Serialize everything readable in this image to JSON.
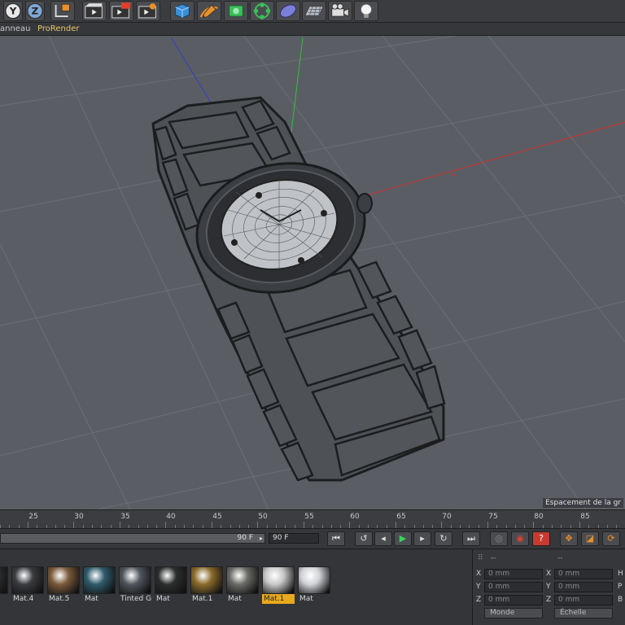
{
  "toolbar": {
    "buttons": [
      {
        "icon": "axis-y-icon",
        "label": "Y"
      },
      {
        "icon": "axis-z-icon",
        "label": "Z"
      },
      {
        "icon": "coordinate-system-icon"
      },
      {
        "icon": "render-view-icon"
      },
      {
        "icon": "render-picture-viewer-icon"
      },
      {
        "icon": "render-settings-icon"
      },
      {
        "icon": "cube-primitive-icon"
      },
      {
        "icon": "pen-spline-icon"
      },
      {
        "icon": "nurbs-icon"
      },
      {
        "icon": "array-cloner-icon"
      },
      {
        "icon": "deformer-icon"
      },
      {
        "icon": "floor-scene-icon"
      },
      {
        "icon": "camera-icon"
      },
      {
        "icon": "light-icon"
      }
    ]
  },
  "menubar": {
    "items": [
      "anneau",
      "ProRender"
    ]
  },
  "viewport": {
    "grid_spacing_label": "Espacement de la gr"
  },
  "timeline": {
    "ticks": [
      "25",
      "30",
      "35",
      "40",
      "45",
      "50",
      "55",
      "60",
      "65",
      "70",
      "75",
      "80",
      "85"
    ]
  },
  "transport": {
    "slider_value": "90 F",
    "slider_arrow": "▸",
    "end_frame": "90 F",
    "buttons": [
      {
        "icon": "go-to-start-icon",
        "glyph": "⏮"
      },
      {
        "icon": "go-to-previous-keyframe-icon",
        "glyph": "↺"
      },
      {
        "icon": "previous-frame-icon",
        "glyph": "◂"
      },
      {
        "icon": "play-forward-icon",
        "glyph": "▶"
      },
      {
        "icon": "next-frame-icon",
        "glyph": "▸"
      },
      {
        "icon": "go-to-next-keyframe-icon",
        "glyph": "↻"
      },
      {
        "icon": "go-to-end-icon",
        "glyph": "⏭"
      },
      {
        "icon": "record-keyframes-icon",
        "glyph": "◎"
      },
      {
        "icon": "autokeying-icon",
        "glyph": "◉"
      },
      {
        "icon": "keyframe-selection-icon",
        "glyph": "?"
      },
      {
        "icon": "record-position-icon",
        "glyph": "✥"
      },
      {
        "icon": "record-scale-icon",
        "glyph": "◪"
      },
      {
        "icon": "record-rotation-icon",
        "glyph": "⟳"
      }
    ]
  },
  "materials": [
    {
      "label": "",
      "color": "#2d2f32"
    },
    {
      "label": "Mat.4",
      "color": "#3a3c40"
    },
    {
      "label": "Mat.5",
      "color": "#7a5a3a"
    },
    {
      "label": "Mat",
      "color": "#2e5a6a"
    },
    {
      "label": "Tinted G",
      "color": "#50545c"
    },
    {
      "label": "Mat",
      "color": "#2c2e2e"
    },
    {
      "label": "Mat.1",
      "color": "#8a6a2a"
    },
    {
      "label": "Mat",
      "color": "#6a6a66"
    },
    {
      "label": "Mat.1",
      "color": "#c8c8c8",
      "selected": true
    },
    {
      "label": "Mat",
      "color": "#d0d2d6"
    }
  ],
  "coords": {
    "header_left": "--",
    "header_right": "--",
    "rows": [
      {
        "a1": "X",
        "v1": "0 mm",
        "a2": "X",
        "v2": "0 mm",
        "a3": "H"
      },
      {
        "a1": "Y",
        "v1": "0 mm",
        "a2": "Y",
        "v2": "0 mm",
        "a3": "P"
      },
      {
        "a1": "Z",
        "v1": "0 mm",
        "a2": "Z",
        "v2": "0 mm",
        "a3": "B"
      }
    ],
    "mode_left": "Monde",
    "mode_right": "Échelle"
  }
}
